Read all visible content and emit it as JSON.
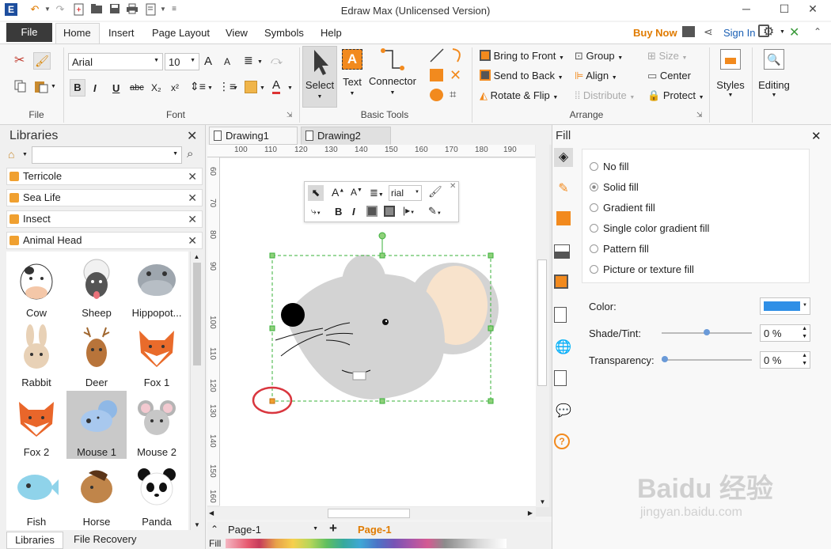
{
  "app": {
    "title": "Edraw Max (Unlicensed Version)",
    "window_controls": {
      "minimize": "─",
      "maximize": "☐",
      "close": "✕"
    }
  },
  "quick_access": [
    "undo",
    "redo",
    "new",
    "open",
    "save",
    "print",
    "export",
    "more"
  ],
  "menu": {
    "file": "File",
    "tabs": [
      "Home",
      "Insert",
      "Page Layout",
      "View",
      "Symbols",
      "Help"
    ],
    "buy_now": "Buy Now",
    "sign_in": "Sign In"
  },
  "ribbon": {
    "file_group": {
      "label": "File"
    },
    "font_group": {
      "label": "Font",
      "font_name": "Arial",
      "font_size": "10",
      "bold": "B",
      "italic": "I",
      "underline": "U",
      "strike": "abc",
      "subscript": "X₂",
      "superscript": "x²",
      "grow": "A",
      "shrink": "A",
      "font_color": "A"
    },
    "basic_tools": {
      "label": "Basic Tools",
      "select": "Select",
      "text": "Text",
      "connector": "Connector"
    },
    "arrange": {
      "label": "Arrange",
      "bring_to_front": "Bring to Front",
      "send_to_back": "Send to Back",
      "rotate_flip": "Rotate & Flip",
      "group": "Group",
      "align": "Align",
      "distribute": "Distribute",
      "size": "Size",
      "center": "Center",
      "protect": "Protect"
    },
    "styles": "Styles",
    "editing": "Editing"
  },
  "libraries": {
    "title": "Libraries",
    "search_placeholder": "",
    "categories": [
      "Terricole",
      "Sea Life",
      "Insect",
      "Animal Head"
    ],
    "shapes": [
      {
        "label": "Cow"
      },
      {
        "label": "Sheep"
      },
      {
        "label": "Hippopot..."
      },
      {
        "label": "Rabbit"
      },
      {
        "label": "Deer"
      },
      {
        "label": "Fox 1"
      },
      {
        "label": "Fox 2"
      },
      {
        "label": "Mouse 1",
        "selected": true
      },
      {
        "label": "Mouse 2"
      },
      {
        "label": "Fish"
      },
      {
        "label": "Horse"
      },
      {
        "label": "Panda"
      }
    ],
    "bottom_tabs": [
      "Libraries",
      "File Recovery"
    ]
  },
  "documents": {
    "tabs": [
      "Drawing1",
      "Drawing2"
    ],
    "active_tab": "Drawing2"
  },
  "rulers": {
    "horizontal": [
      "100",
      "110",
      "120",
      "130",
      "140",
      "150",
      "160",
      "170",
      "180",
      "190"
    ],
    "vertical": [
      "60",
      "70",
      "80",
      "90",
      "100",
      "110",
      "120",
      "130",
      "140",
      "150",
      "160"
    ]
  },
  "mini_toolbar": {
    "font": "rial",
    "bold": "B",
    "italic": "I"
  },
  "pages": {
    "current": "Page-1",
    "tab": "Page-1",
    "add": "+"
  },
  "fill_panel": {
    "title": "Fill",
    "options": [
      "No fill",
      "Solid fill",
      "Gradient fill",
      "Single color gradient fill",
      "Pattern fill",
      "Picture or texture fill"
    ],
    "selected": "Solid fill",
    "color_label": "Color:",
    "color_value": "#2f8fe6",
    "shade_label": "Shade/Tint:",
    "shade_value": "0 %",
    "transparency_label": "Transparency:",
    "transparency_value": "0 %"
  },
  "status": {
    "fill_label": "Fill"
  },
  "colors": {
    "accent": "#c0392b",
    "buy_now": "#e07b00",
    "page_tab": "#e07b00",
    "highlight_circle": "#d9363e",
    "mouse_body": "#d3d3d3",
    "mouse_ear_inner": "#f8e3cc"
  },
  "watermark": {
    "brand": "Baidu 经验",
    "url": "jingyan.baidu.com"
  }
}
